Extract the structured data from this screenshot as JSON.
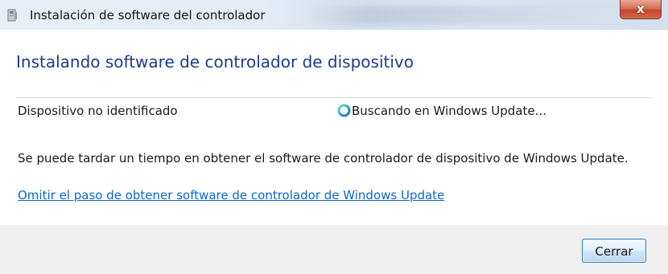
{
  "window": {
    "title": "Instalación de software del controlador"
  },
  "dialog": {
    "heading": "Instalando software de controlador de dispositivo",
    "device": {
      "name": "Dispositivo no identificado",
      "status": "Buscando en Windows Update...",
      "status_icon": "spinner-icon"
    },
    "info_text": "Se puede tardar un tiempo en obtener el software de controlador de dispositivo de Windows Update.",
    "skip_link": "Omitir el paso de obtener software de controlador de Windows Update",
    "close_button_label": "Cerrar"
  },
  "colors": {
    "heading": "#1e3b8c",
    "link": "#0a66cc",
    "close_red": "#c2462c",
    "footer_bg": "#f0f0f0"
  }
}
